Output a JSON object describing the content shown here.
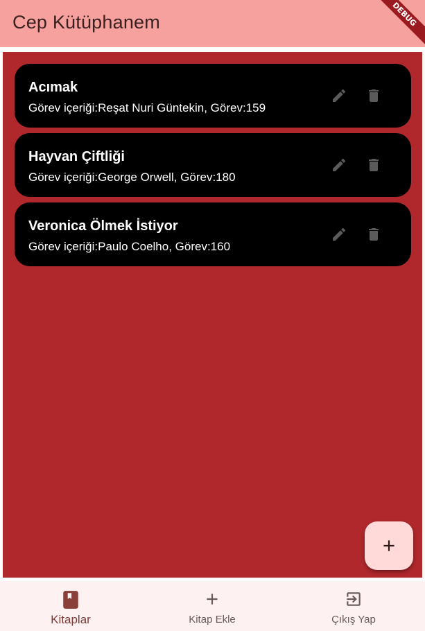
{
  "app_bar": {
    "title": "Cep Kütüphanem",
    "debug_banner": "DEBUG"
  },
  "books": [
    {
      "name": "Acımak",
      "description": "Görev içeriği:Reşat Nuri Güntekin, Görev:159"
    },
    {
      "name": "Hayvan Çiftliği",
      "description": "Görev içeriği:George Orwell, Görev:180"
    },
    {
      "name": "Veronica Ölmek İstiyor",
      "description": "Görev içeriği:Paulo Coelho, Görev:160"
    }
  ],
  "icons": {
    "edit": "pencil-icon",
    "delete": "trash-icon",
    "fab": "plus-icon"
  },
  "bottom_nav": {
    "items": [
      {
        "label": "Kitaplar",
        "icon": "book-icon",
        "active": true
      },
      {
        "label": "Kitap Ekle",
        "icon": "plus-icon",
        "active": false
      },
      {
        "label": "Çıkış Yap",
        "icon": "exit-icon",
        "active": false
      }
    ]
  },
  "colors": {
    "app_bar": "#f7a19e",
    "background": "#b0282c",
    "card": "#000000",
    "fab": "#ffdad8",
    "bottom_nav": "#fdf2f1",
    "debug": "#9b1a20"
  }
}
